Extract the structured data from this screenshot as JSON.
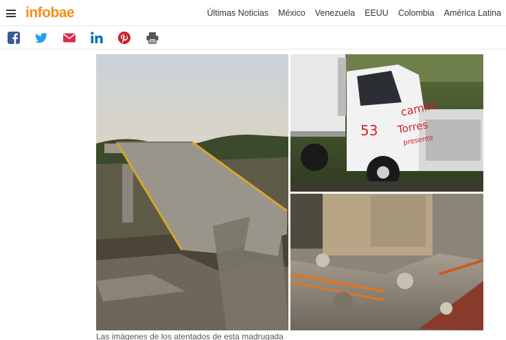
{
  "header": {
    "logo_text": "infobae",
    "nav": [
      {
        "label": "Últimas Noticias"
      },
      {
        "label": "México"
      },
      {
        "label": "Venezuela"
      },
      {
        "label": "EEUU"
      },
      {
        "label": "Colombia"
      },
      {
        "label": "América Latina"
      }
    ]
  },
  "share": [
    {
      "icon": "facebook-icon",
      "color": "#3b5998"
    },
    {
      "icon": "twitter-icon",
      "color": "#1da1f2"
    },
    {
      "icon": "email-icon",
      "color": "#e0284a"
    },
    {
      "icon": "linkedin-icon",
      "color": "#0077b5"
    },
    {
      "icon": "pinterest-icon",
      "color": "#cb2027"
    },
    {
      "icon": "print-icon",
      "color": "#555555"
    }
  ],
  "article": {
    "image_text": {
      "graffiti_line1": "camilo",
      "graffiti_line2": "Torres",
      "graffiti_line3": "presente",
      "graffiti_number": "53"
    },
    "caption": "Las imágenes de los atentados de esta madrugada"
  },
  "colors": {
    "brand": "#f68e1e"
  }
}
